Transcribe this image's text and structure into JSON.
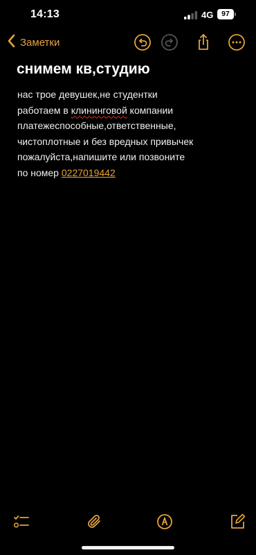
{
  "status_bar": {
    "time": "14:13",
    "network": "4G",
    "battery": "97"
  },
  "nav": {
    "back_label": "Заметки"
  },
  "note": {
    "title": "снимем кв,студию",
    "line1": "нас трое девушек,не студентки",
    "line2_pre": "работаем в ",
    "line2_misspelled": "клининговой",
    "line2_post": " компании",
    "line3": "платежеспособные,ответственные,",
    "line4": "чистоплотные и без вредных привычек",
    "line5": "пожалуйста,напишите или позвоните",
    "line6_pre": "по номер ",
    "phone": "0227019442"
  },
  "colors": {
    "accent": "#e6a33b",
    "background": "#000000",
    "text": "#ffffff",
    "spellcheck": "#e0302c"
  },
  "icons": {
    "back": "chevron-left-icon",
    "undo": "undo-icon",
    "redo": "redo-icon",
    "share": "share-icon",
    "more": "more-icon",
    "checklist": "checklist-icon",
    "attach": "paperclip-icon",
    "markup": "pen-markup-icon",
    "compose": "compose-icon"
  }
}
